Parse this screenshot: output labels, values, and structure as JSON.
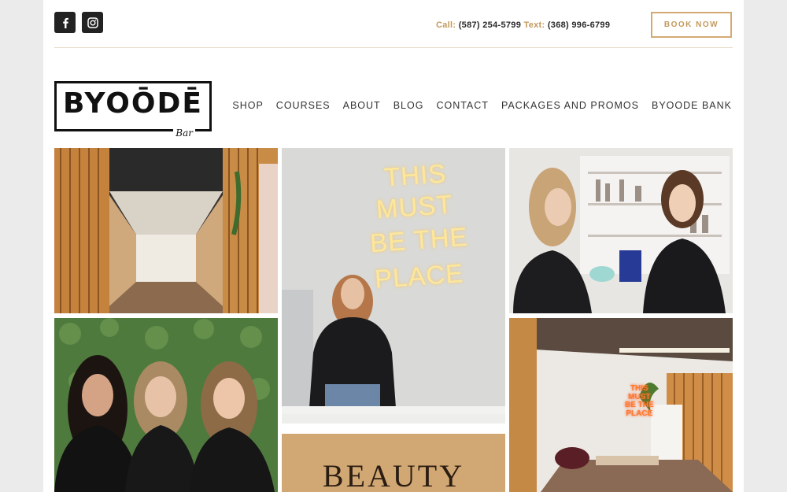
{
  "header": {
    "social": [
      {
        "name": "facebook-icon",
        "glyph": "f"
      },
      {
        "name": "instagram-icon",
        "glyph": ""
      }
    ],
    "call_label": "Call:",
    "call_number": "(587) 254-5799",
    "text_label": "Text:",
    "text_number": "(368) 996-6799",
    "book_now": "BOOK NOW"
  },
  "logo": {
    "main": "BYOŌDĒ",
    "sub": "Bar"
  },
  "nav": {
    "items": [
      "SHOP",
      "COURSES",
      "ABOUT",
      "BLOG",
      "CONTACT",
      "PACKAGES AND PROMOS",
      "BYOODE BANK"
    ]
  },
  "gallery": {
    "neon_sign": [
      "THIS",
      "MUST",
      "BE THE",
      "PLACE"
    ],
    "small_neon_sign": [
      "THIS",
      "MUST",
      "BE THE",
      "PLACE"
    ],
    "beauty_text": "BEAUTY"
  },
  "colors": {
    "accent": "#c39a5c",
    "book_border": "#d4aa74",
    "rule": "#e7dcc8",
    "dark": "#222222"
  }
}
